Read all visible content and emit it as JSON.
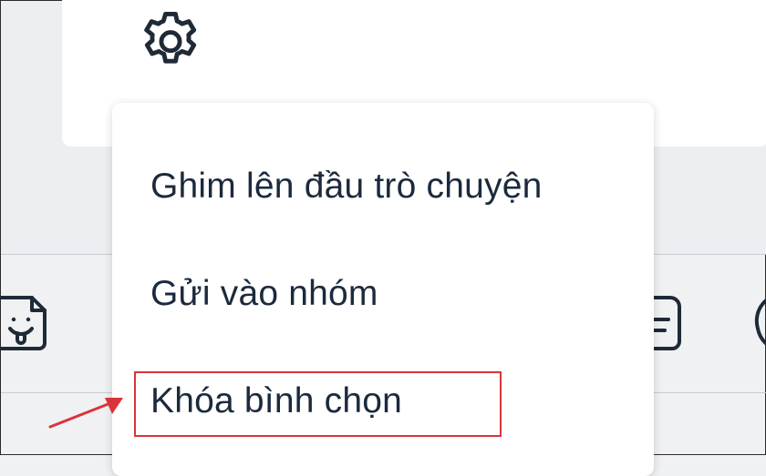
{
  "context_menu": {
    "items": [
      {
        "label": "Ghim lên đầu trò chuyện"
      },
      {
        "label": "Gửi vào nhóm"
      },
      {
        "label": "Khóa bình chọn"
      }
    ]
  },
  "icons": {
    "settings": "gear-icon",
    "sticker": "sticker-icon",
    "note": "note-icon",
    "clock": "clock-icon",
    "annotation_arrow": "arrow-icon"
  },
  "colors": {
    "highlight": "#d9343a",
    "menu_text": "#1b2a3d",
    "icon_stroke": "#1f2a37"
  }
}
